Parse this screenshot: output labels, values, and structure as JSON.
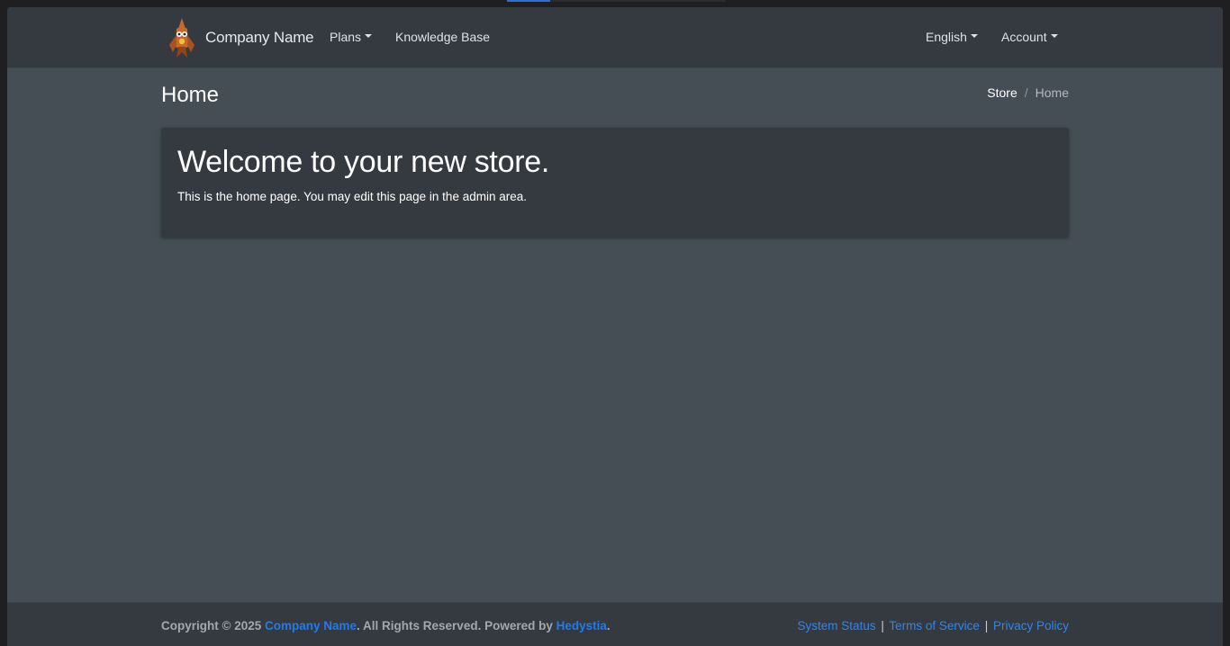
{
  "navbar": {
    "brand_name": "Company Name",
    "logo_icon": "rocket-logo-icon",
    "links": {
      "plans": "Plans",
      "knowledge_base": "Knowledge Base",
      "language": "English",
      "account": "Account"
    }
  },
  "header": {
    "title": "Home",
    "breadcrumb": {
      "store": "Store",
      "separator": "/",
      "current": "Home"
    }
  },
  "card": {
    "title": "Welcome to your new store.",
    "text": "This is the home page. You may edit this page in the admin area."
  },
  "footer": {
    "copyright_prefix": "Copyright © 2025",
    "company_link": "Company Name",
    "rights_text": ". All Rights Reserved. Powered by",
    "powered_link": "Hedystia",
    "end_dot": ".",
    "links": {
      "status": "System Status",
      "terms": "Terms of Service",
      "privacy": "Privacy Policy"
    },
    "pipe": "|"
  },
  "colors": {
    "page_bg": "#454d55",
    "navbar_bg": "#343a40",
    "link_blue": "#1e7bf0"
  }
}
